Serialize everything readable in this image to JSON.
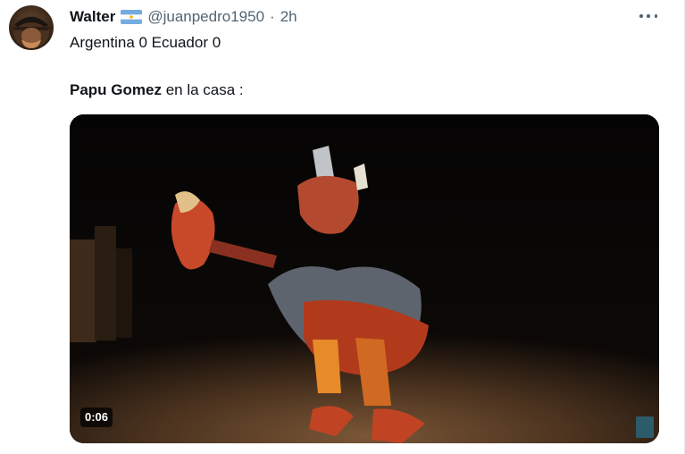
{
  "tweet": {
    "author": {
      "display_name": "Walter",
      "handle": "@juanpedro1950",
      "separator": "·",
      "time": "2h",
      "flag_icon": "argentina-flag-icon"
    },
    "text_line_1": "Argentina 0 Ecuador 0",
    "text_line_2_bold": "Papu Gomez",
    "text_line_2_rest": " en la casa :",
    "media": {
      "type": "video",
      "duration": "0:06"
    },
    "more_icon": "more-horizontal-icon"
  },
  "colors": {
    "text_primary": "#0f1419",
    "text_secondary": "#536471",
    "flag_blue": "#74acdf",
    "flag_sun": "#f6b40e"
  }
}
